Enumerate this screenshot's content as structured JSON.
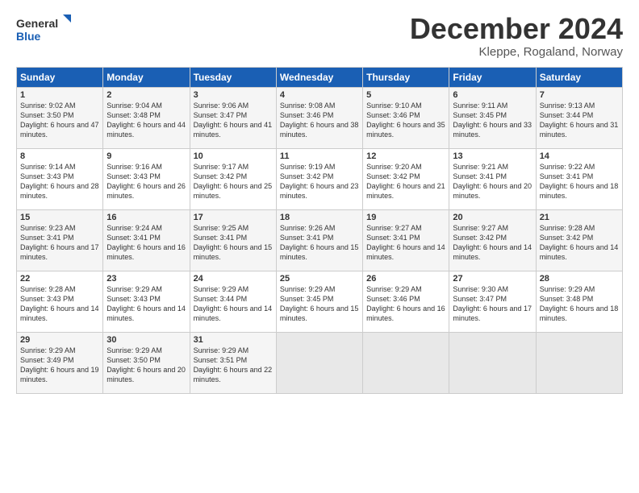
{
  "logo": {
    "line1": "General",
    "line2": "Blue"
  },
  "title": "December 2024",
  "location": "Kleppe, Rogaland, Norway",
  "days_header": [
    "Sunday",
    "Monday",
    "Tuesday",
    "Wednesday",
    "Thursday",
    "Friday",
    "Saturday"
  ],
  "weeks": [
    [
      {
        "day": "1",
        "sunrise": "9:02 AM",
        "sunset": "3:50 PM",
        "daylight": "6 hours and 47 minutes."
      },
      {
        "day": "2",
        "sunrise": "9:04 AM",
        "sunset": "3:48 PM",
        "daylight": "6 hours and 44 minutes."
      },
      {
        "day": "3",
        "sunrise": "9:06 AM",
        "sunset": "3:47 PM",
        "daylight": "6 hours and 41 minutes."
      },
      {
        "day": "4",
        "sunrise": "9:08 AM",
        "sunset": "3:46 PM",
        "daylight": "6 hours and 38 minutes."
      },
      {
        "day": "5",
        "sunrise": "9:10 AM",
        "sunset": "3:46 PM",
        "daylight": "6 hours and 35 minutes."
      },
      {
        "day": "6",
        "sunrise": "9:11 AM",
        "sunset": "3:45 PM",
        "daylight": "6 hours and 33 minutes."
      },
      {
        "day": "7",
        "sunrise": "9:13 AM",
        "sunset": "3:44 PM",
        "daylight": "6 hours and 31 minutes."
      }
    ],
    [
      {
        "day": "8",
        "sunrise": "9:14 AM",
        "sunset": "3:43 PM",
        "daylight": "6 hours and 28 minutes."
      },
      {
        "day": "9",
        "sunrise": "9:16 AM",
        "sunset": "3:43 PM",
        "daylight": "6 hours and 26 minutes."
      },
      {
        "day": "10",
        "sunrise": "9:17 AM",
        "sunset": "3:42 PM",
        "daylight": "6 hours and 25 minutes."
      },
      {
        "day": "11",
        "sunrise": "9:19 AM",
        "sunset": "3:42 PM",
        "daylight": "6 hours and 23 minutes."
      },
      {
        "day": "12",
        "sunrise": "9:20 AM",
        "sunset": "3:42 PM",
        "daylight": "6 hours and 21 minutes."
      },
      {
        "day": "13",
        "sunrise": "9:21 AM",
        "sunset": "3:41 PM",
        "daylight": "6 hours and 20 minutes."
      },
      {
        "day": "14",
        "sunrise": "9:22 AM",
        "sunset": "3:41 PM",
        "daylight": "6 hours and 18 minutes."
      }
    ],
    [
      {
        "day": "15",
        "sunrise": "9:23 AM",
        "sunset": "3:41 PM",
        "daylight": "6 hours and 17 minutes."
      },
      {
        "day": "16",
        "sunrise": "9:24 AM",
        "sunset": "3:41 PM",
        "daylight": "6 hours and 16 minutes."
      },
      {
        "day": "17",
        "sunrise": "9:25 AM",
        "sunset": "3:41 PM",
        "daylight": "6 hours and 15 minutes."
      },
      {
        "day": "18",
        "sunrise": "9:26 AM",
        "sunset": "3:41 PM",
        "daylight": "6 hours and 15 minutes."
      },
      {
        "day": "19",
        "sunrise": "9:27 AM",
        "sunset": "3:41 PM",
        "daylight": "6 hours and 14 minutes."
      },
      {
        "day": "20",
        "sunrise": "9:27 AM",
        "sunset": "3:42 PM",
        "daylight": "6 hours and 14 minutes."
      },
      {
        "day": "21",
        "sunrise": "9:28 AM",
        "sunset": "3:42 PM",
        "daylight": "6 hours and 14 minutes."
      }
    ],
    [
      {
        "day": "22",
        "sunrise": "9:28 AM",
        "sunset": "3:43 PM",
        "daylight": "6 hours and 14 minutes."
      },
      {
        "day": "23",
        "sunrise": "9:29 AM",
        "sunset": "3:43 PM",
        "daylight": "6 hours and 14 minutes."
      },
      {
        "day": "24",
        "sunrise": "9:29 AM",
        "sunset": "3:44 PM",
        "daylight": "6 hours and 14 minutes."
      },
      {
        "day": "25",
        "sunrise": "9:29 AM",
        "sunset": "3:45 PM",
        "daylight": "6 hours and 15 minutes."
      },
      {
        "day": "26",
        "sunrise": "9:29 AM",
        "sunset": "3:46 PM",
        "daylight": "6 hours and 16 minutes."
      },
      {
        "day": "27",
        "sunrise": "9:30 AM",
        "sunset": "3:47 PM",
        "daylight": "6 hours and 17 minutes."
      },
      {
        "day": "28",
        "sunrise": "9:29 AM",
        "sunset": "3:48 PM",
        "daylight": "6 hours and 18 minutes."
      }
    ],
    [
      {
        "day": "29",
        "sunrise": "9:29 AM",
        "sunset": "3:49 PM",
        "daylight": "6 hours and 19 minutes."
      },
      {
        "day": "30",
        "sunrise": "9:29 AM",
        "sunset": "3:50 PM",
        "daylight": "6 hours and 20 minutes."
      },
      {
        "day": "31",
        "sunrise": "9:29 AM",
        "sunset": "3:51 PM",
        "daylight": "6 hours and 22 minutes."
      },
      null,
      null,
      null,
      null
    ]
  ]
}
